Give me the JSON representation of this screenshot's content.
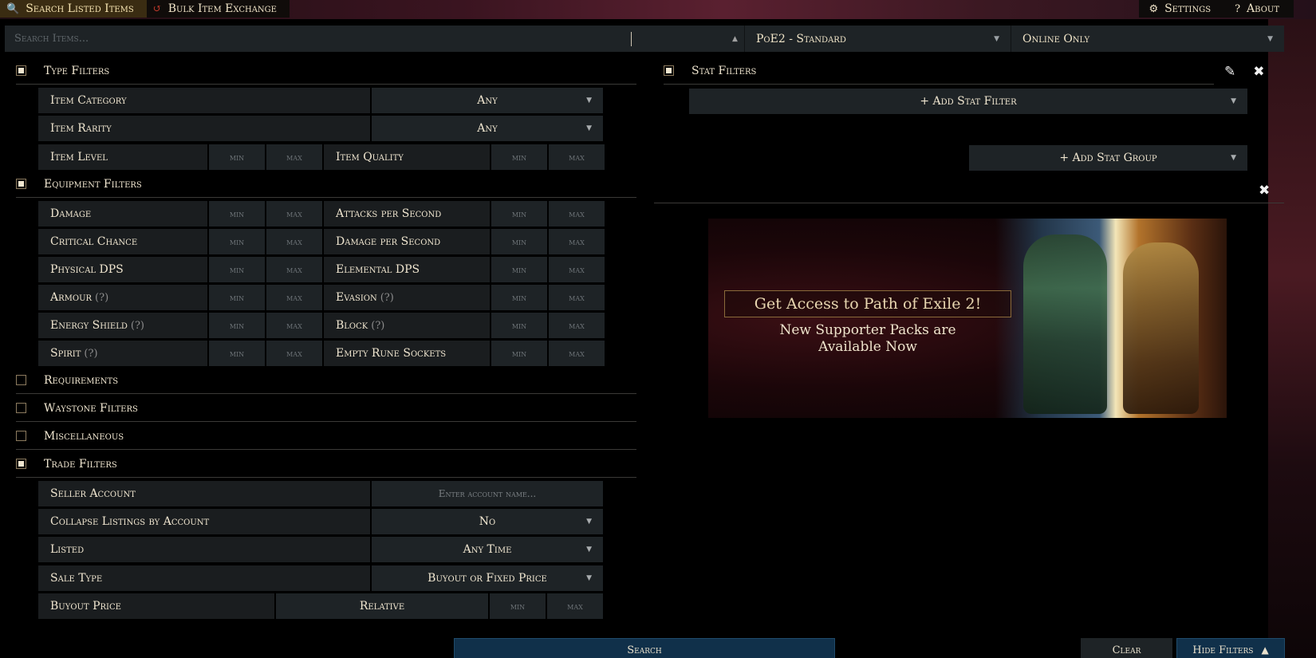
{
  "nav": {
    "tabs": [
      {
        "label": "Search Listed Items",
        "icon": "search-icon"
      },
      {
        "label": "Bulk Item Exchange",
        "icon": "exchange-icon"
      }
    ],
    "settings_label": "Settings",
    "about_label": "About"
  },
  "search": {
    "placeholder": "Search Items...",
    "league": "PoE2 - Standard",
    "status": "Online Only"
  },
  "type_filters": {
    "title": "Type Filters",
    "checked": true,
    "item_category": {
      "label": "Item Category",
      "value": "Any"
    },
    "item_rarity": {
      "label": "Item Rarity",
      "value": "Any"
    },
    "item_level": {
      "label": "Item Level"
    },
    "item_quality": {
      "label": "Item Quality"
    }
  },
  "equipment_filters": {
    "title": "Equipment Filters",
    "checked": true,
    "rows": [
      {
        "left": "Damage",
        "left_help": "",
        "right": "Attacks per Second",
        "right_help": ""
      },
      {
        "left": "Critical Chance",
        "left_help": "",
        "right": "Damage per Second",
        "right_help": ""
      },
      {
        "left": "Physical DPS",
        "left_help": "",
        "right": "Elemental DPS",
        "right_help": ""
      },
      {
        "left": "Armour",
        "left_help": "(?)",
        "right": "Evasion",
        "right_help": "(?)"
      },
      {
        "left": "Energy Shield",
        "left_help": "(?)",
        "right": "Block",
        "right_help": "(?)"
      },
      {
        "left": "Spirit",
        "left_help": "(?)",
        "right": "Empty Rune Sockets",
        "right_help": ""
      }
    ]
  },
  "min_label": "min",
  "max_label": "max",
  "collapsed_sections": [
    {
      "title": "Requirements"
    },
    {
      "title": "Waystone Filters"
    },
    {
      "title": "Miscellaneous"
    }
  ],
  "trade_filters": {
    "title": "Trade Filters",
    "checked": true,
    "seller_account": {
      "label": "Seller Account",
      "placeholder": "Enter account name..."
    },
    "collapse_listings": {
      "label": "Collapse Listings by Account",
      "value": "No"
    },
    "listed": {
      "label": "Listed",
      "value": "Any Time"
    },
    "sale_type": {
      "label": "Sale Type",
      "value": "Buyout or Fixed Price"
    },
    "buyout_price": {
      "label": "Buyout Price",
      "mode": "Relative"
    }
  },
  "stat_filters": {
    "title": "Stat Filters",
    "checked": true,
    "add_stat_filter": "+ Add Stat Filter",
    "add_stat_group": "+ Add Stat Group"
  },
  "banner": {
    "title": "Get Access to Path of Exile 2!",
    "subtitle_line1": "New Supporter Packs are",
    "subtitle_line2": "Available Now"
  },
  "buttons": {
    "search": "Search",
    "clear": "Clear",
    "hide_filters": "Hide Filters"
  }
}
